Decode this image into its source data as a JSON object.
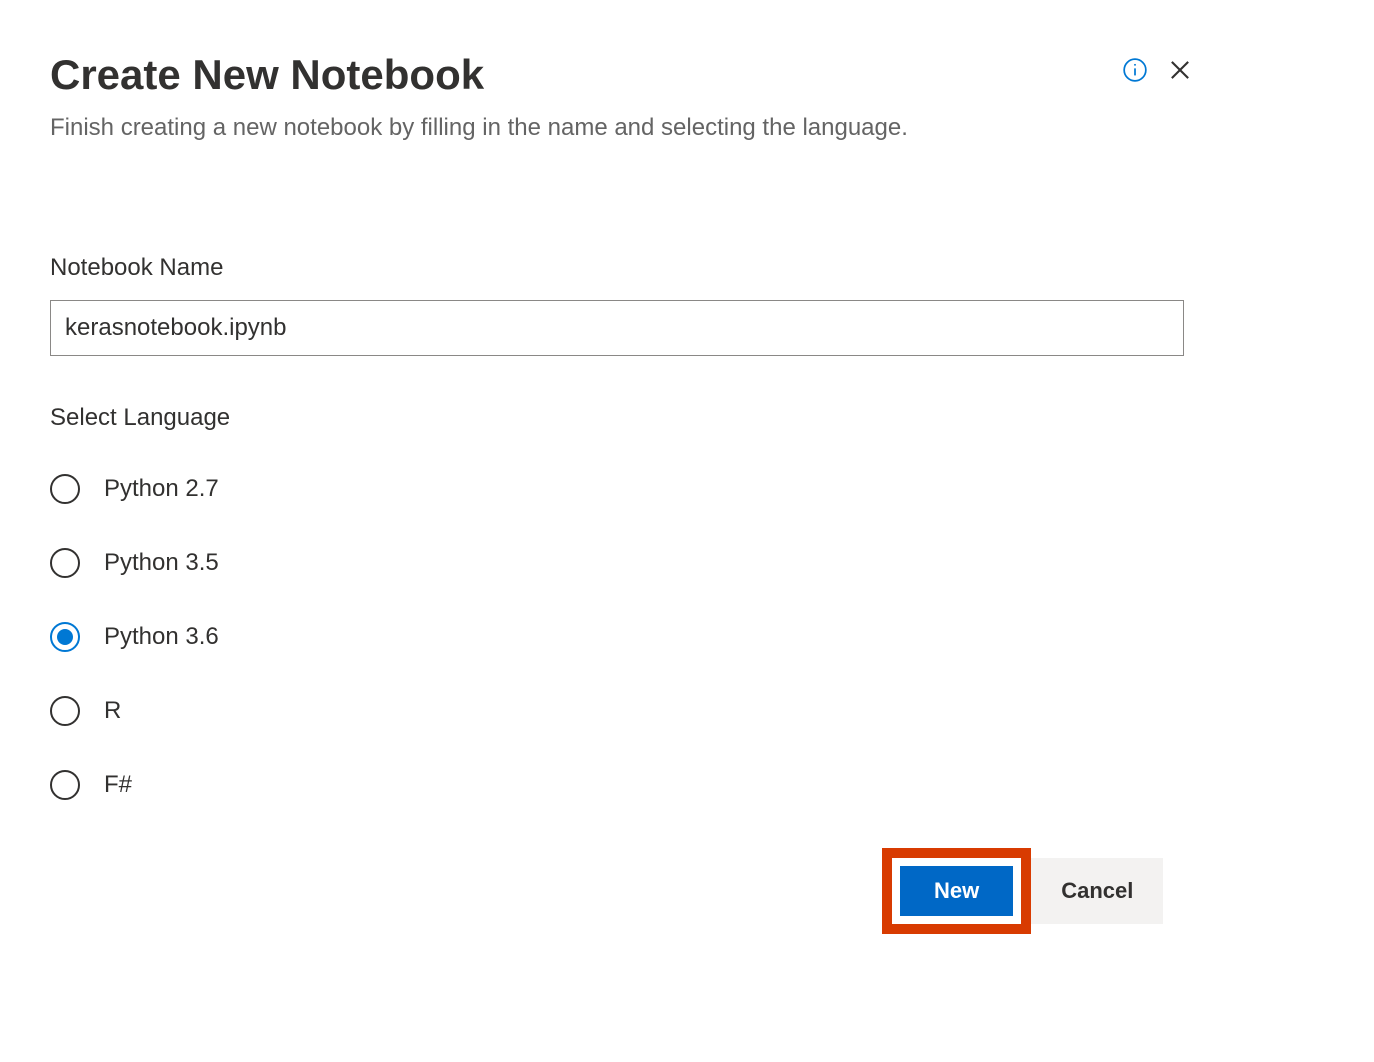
{
  "dialog": {
    "title": "Create New Notebook",
    "subtitle": "Finish creating a new notebook by filling in the name and selecting the language."
  },
  "fields": {
    "notebook_name_label": "Notebook Name",
    "notebook_name_value": "kerasnotebook.ipynb",
    "select_language_label": "Select Language"
  },
  "languages": {
    "options": [
      {
        "label": "Python 2.7",
        "selected": false
      },
      {
        "label": "Python 3.5",
        "selected": false
      },
      {
        "label": "Python 3.6",
        "selected": true
      },
      {
        "label": "R",
        "selected": false
      },
      {
        "label": "F#",
        "selected": false
      }
    ]
  },
  "buttons": {
    "new_label": "New",
    "cancel_label": "Cancel"
  },
  "colors": {
    "accent": "#0078d4",
    "primary_button": "#0068c6",
    "highlight": "#d83b01",
    "secondary_button": "#f3f2f1"
  }
}
